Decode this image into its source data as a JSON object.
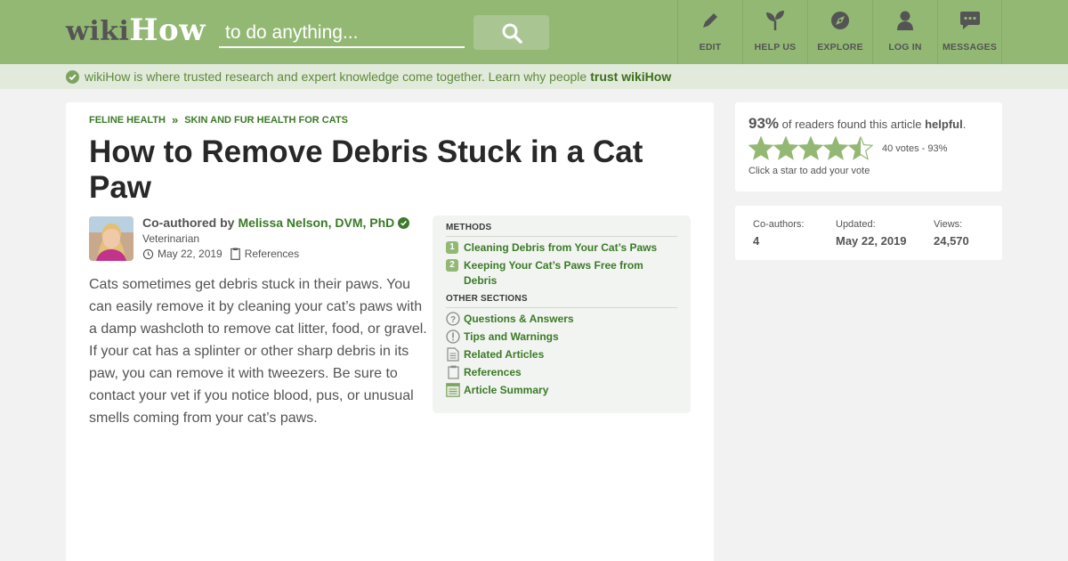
{
  "header": {
    "logo_wiki": "wiki",
    "logo_how": "How",
    "search_placeholder": "to do anything...",
    "nav": [
      {
        "label": "EDIT",
        "icon": "pencil-icon"
      },
      {
        "label": "HELP US",
        "icon": "sprout-icon"
      },
      {
        "label": "EXPLORE",
        "icon": "compass-icon"
      },
      {
        "label": "LOG IN",
        "icon": "user-icon"
      },
      {
        "label": "MESSAGES",
        "icon": "chat-bubble-icon"
      }
    ]
  },
  "trust_bar": {
    "text": "wikiHow is where trusted research and expert knowledge come together. Learn why people",
    "link": "trust wikiHow"
  },
  "article": {
    "breadcrumbs": [
      "FELINE HEALTH",
      "SKIN AND FUR HEALTH FOR CATS"
    ],
    "breadcrumb_sep": "»",
    "title": "How to Remove Debris Stuck in a Cat Paw",
    "coauthored_by": "Co-authored by",
    "author_name": "Melissa Nelson, DVM, PhD",
    "author_role": "Veterinarian",
    "date": "May 22, 2019",
    "references_label": "References",
    "intro": "Cats sometimes get debris stuck in their paws. You can easily remove it by cleaning your cat’s paws with a damp washcloth to remove cat litter, food, or gravel. If your cat has a splinter or other sharp debris in its paw, you can remove it with tweezers. Be sure to contact your vet if you notice blood, pus, or unusual smells coming from your cat’s paws."
  },
  "toc": {
    "methods_heading": "METHODS",
    "methods": [
      {
        "num": "1",
        "label": "Cleaning Debris from Your Cat’s Paws"
      },
      {
        "num": "2",
        "label": "Keeping Your Cat’s Paws Free from Debris"
      }
    ],
    "other_heading": "OTHER SECTIONS",
    "other": [
      {
        "label": "Questions & Answers",
        "icon": "question-icon"
      },
      {
        "label": "Tips and Warnings",
        "icon": "exclamation-icon"
      },
      {
        "label": "Related Articles",
        "icon": "document-icon"
      },
      {
        "label": "References",
        "icon": "clipboard-icon"
      },
      {
        "label": "Article Summary",
        "icon": "summary-icon"
      }
    ]
  },
  "rating": {
    "percent": "93%",
    "text_mid": "of readers found this article",
    "helpful": "helpful",
    "period": ".",
    "stars_filled": 4.5,
    "stars_total": 5,
    "votes": "40 votes - 93%",
    "hint": "Click a star to add your vote"
  },
  "stats": {
    "coauthors_label": "Co-authors:",
    "coauthors_value": "4",
    "updated_label": "Updated:",
    "updated_value": "May 22, 2019",
    "views_label": "Views:",
    "views_value": "24,570"
  },
  "colors": {
    "brand_green": "#93b874",
    "link_green": "#3b7a27",
    "trust_bg": "#e1eadb"
  }
}
